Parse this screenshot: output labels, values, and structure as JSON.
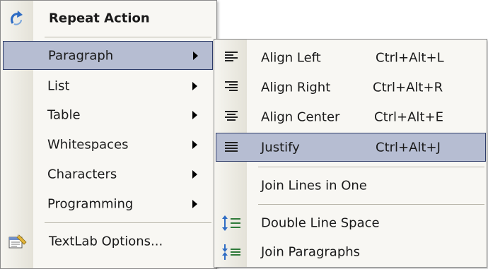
{
  "main_menu": {
    "header": {
      "label": "Repeat Action",
      "icon": "repeat-arrow-icon"
    },
    "items": [
      {
        "label": "Paragraph"
      },
      {
        "label": "List"
      },
      {
        "label": "Table"
      },
      {
        "label": "Whitespaces"
      },
      {
        "label": "Characters"
      },
      {
        "label": "Programming"
      }
    ],
    "footer": {
      "label": "TextLab Options...",
      "icon": "options-icon"
    }
  },
  "submenu": {
    "align_items": [
      {
        "label": "Align Left",
        "shortcut": "Ctrl+Alt+L",
        "icon": "align-left-icon"
      },
      {
        "label": "Align Right",
        "shortcut": "Ctrl+Alt+R",
        "icon": "align-right-icon"
      },
      {
        "label": "Align Center",
        "shortcut": "Ctrl+Alt+E",
        "icon": "align-center-icon"
      },
      {
        "label": "Justify",
        "shortcut": "Ctrl+Alt+J",
        "icon": "justify-icon"
      }
    ],
    "join_lines": {
      "label": "Join Lines in One"
    },
    "spacing_items": [
      {
        "label": "Double Line Space",
        "icon": "double-line-space-icon"
      },
      {
        "label": "Join Paragraphs",
        "icon": "join-paragraphs-icon"
      }
    ]
  },
  "colors": {
    "highlight": "#b6bdd2",
    "highlight_border": "#2f3d6a",
    "menu_bg": "#f8f7f3"
  }
}
